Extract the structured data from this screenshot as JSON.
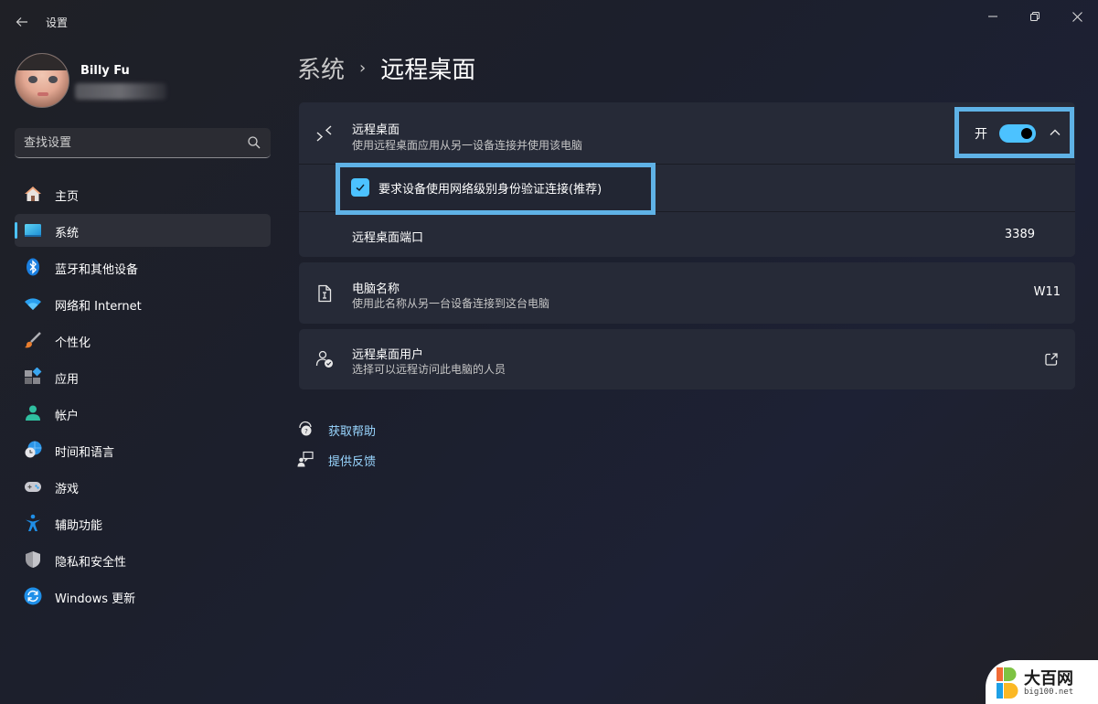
{
  "window": {
    "title": "设置",
    "controls": {
      "minimize": "minimize",
      "maximize": "restore",
      "close": "close"
    }
  },
  "profile": {
    "name": "Billy Fu",
    "email_redacted": true
  },
  "search": {
    "placeholder": "查找设置",
    "value": ""
  },
  "sidebar": {
    "items": [
      {
        "label": "主页",
        "icon": "home-icon",
        "active": false
      },
      {
        "label": "系统",
        "icon": "system-display-icon",
        "active": true
      },
      {
        "label": "蓝牙和其他设备",
        "icon": "bluetooth-icon",
        "active": false
      },
      {
        "label": "网络和 Internet",
        "icon": "wifi-icon",
        "active": false
      },
      {
        "label": "个性化",
        "icon": "brush-icon",
        "active": false
      },
      {
        "label": "应用",
        "icon": "apps-icon",
        "active": false
      },
      {
        "label": "帐户",
        "icon": "account-icon",
        "active": false
      },
      {
        "label": "时间和语言",
        "icon": "time-language-icon",
        "active": false
      },
      {
        "label": "游戏",
        "icon": "gamepad-icon",
        "active": false
      },
      {
        "label": "辅助功能",
        "icon": "accessibility-icon",
        "active": false
      },
      {
        "label": "隐私和安全性",
        "icon": "shield-icon",
        "active": false
      },
      {
        "label": "Windows 更新",
        "icon": "windows-update-icon",
        "active": false
      }
    ]
  },
  "breadcrumb": {
    "parent": "系统",
    "separator": "›",
    "current": "远程桌面"
  },
  "remote_desktop": {
    "title": "远程桌面",
    "subtitle": "使用远程桌面应用从另一设备连接并使用该电脑",
    "toggle_label": "开",
    "toggle_on": true,
    "expanded": true,
    "nla_label": "要求设备使用网络级别身份验证连接(推荐)",
    "nla_checked": true,
    "port_label": "远程桌面端口",
    "port_value": "3389"
  },
  "pc_name": {
    "title": "电脑名称",
    "subtitle": "使用此名称从另一台设备连接到这台电脑",
    "value": "W11"
  },
  "rd_users": {
    "title": "远程桌面用户",
    "subtitle": "选择可以远程访问此电脑的人员"
  },
  "links": {
    "help": "获取帮助",
    "feedback": "提供反馈"
  },
  "watermark": {
    "title": "大百网",
    "subtitle": "big100.net"
  },
  "colors": {
    "accent": "#4cc2ff",
    "highlight_border": "#5fb2e6",
    "card_bg": "#262a37",
    "link": "#99d6ff"
  }
}
